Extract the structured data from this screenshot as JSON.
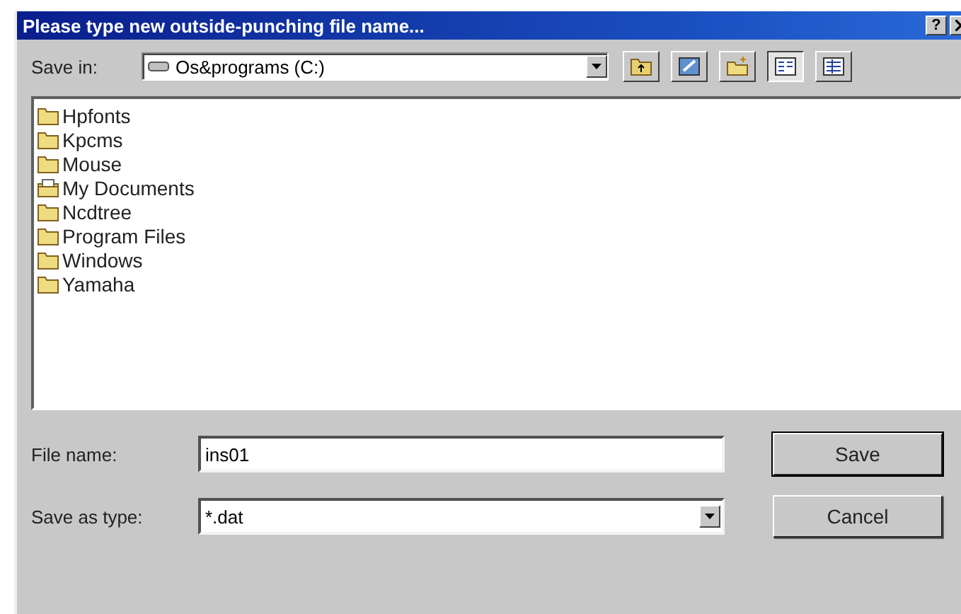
{
  "window": {
    "title": "Please type new outside-punching file name...",
    "help": "?"
  },
  "save_in": {
    "label": "Save in:",
    "value": "Os&programs (C:)"
  },
  "toolbar": [
    {
      "kind": "up"
    },
    {
      "kind": "desktop"
    },
    {
      "kind": "newfolder"
    },
    {
      "kind": "list",
      "selected": true
    },
    {
      "kind": "details",
      "selected": false
    }
  ],
  "files": [
    {
      "name": "Hpfonts",
      "kind": "folder"
    },
    {
      "name": "Kpcms",
      "kind": "folder"
    },
    {
      "name": "Mouse",
      "kind": "folder"
    },
    {
      "name": "My Documents",
      "kind": "documents"
    },
    {
      "name": "Ncdtree",
      "kind": "folder"
    },
    {
      "name": "Program Files",
      "kind": "folder"
    },
    {
      "name": "Windows",
      "kind": "folder"
    },
    {
      "name": "Yamaha",
      "kind": "folder"
    }
  ],
  "file_name": {
    "label": "File name:",
    "value": "ins01"
  },
  "save_as_type": {
    "label": "Save as type:",
    "value": "*.dat"
  },
  "buttons": [
    {
      "label": "Save",
      "default": true
    },
    {
      "label": "Cancel",
      "default": false
    }
  ]
}
